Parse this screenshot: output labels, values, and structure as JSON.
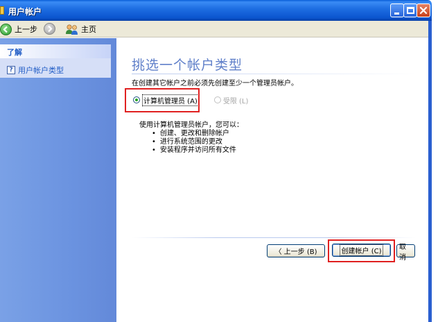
{
  "window": {
    "title": "用户帐户"
  },
  "nav": {
    "back_label": "上一步",
    "home_label": "主页"
  },
  "leftpane": {
    "section_title": "了解",
    "items": [
      {
        "label": "用户帐户类型",
        "icon": "help-icon"
      }
    ]
  },
  "main": {
    "title": "挑选一个帐户类型",
    "instruction": "在创建其它帐户之前必须先创建至少一个管理员帐户。",
    "options": [
      {
        "label": "计算机管理员 (A)",
        "checked": true,
        "enabled": true
      },
      {
        "label": "受限 (L)",
        "checked": false,
        "enabled": false
      }
    ],
    "description_intro": "使用计算机管理员帐户，您可以：",
    "description_items": [
      "创建、更改和删除帐户",
      "进行系统范围的更改",
      "安装程序并访问所有文件"
    ]
  },
  "buttons": {
    "back": "〈 上一步 (B)",
    "create": "创建帐户 (C)",
    "cancel": "取消"
  },
  "colors": {
    "titlebar": "#1f6fe3",
    "leftpane": "#6b93e0",
    "page_title": "#5f7fc9",
    "highlight": "#e02020"
  }
}
